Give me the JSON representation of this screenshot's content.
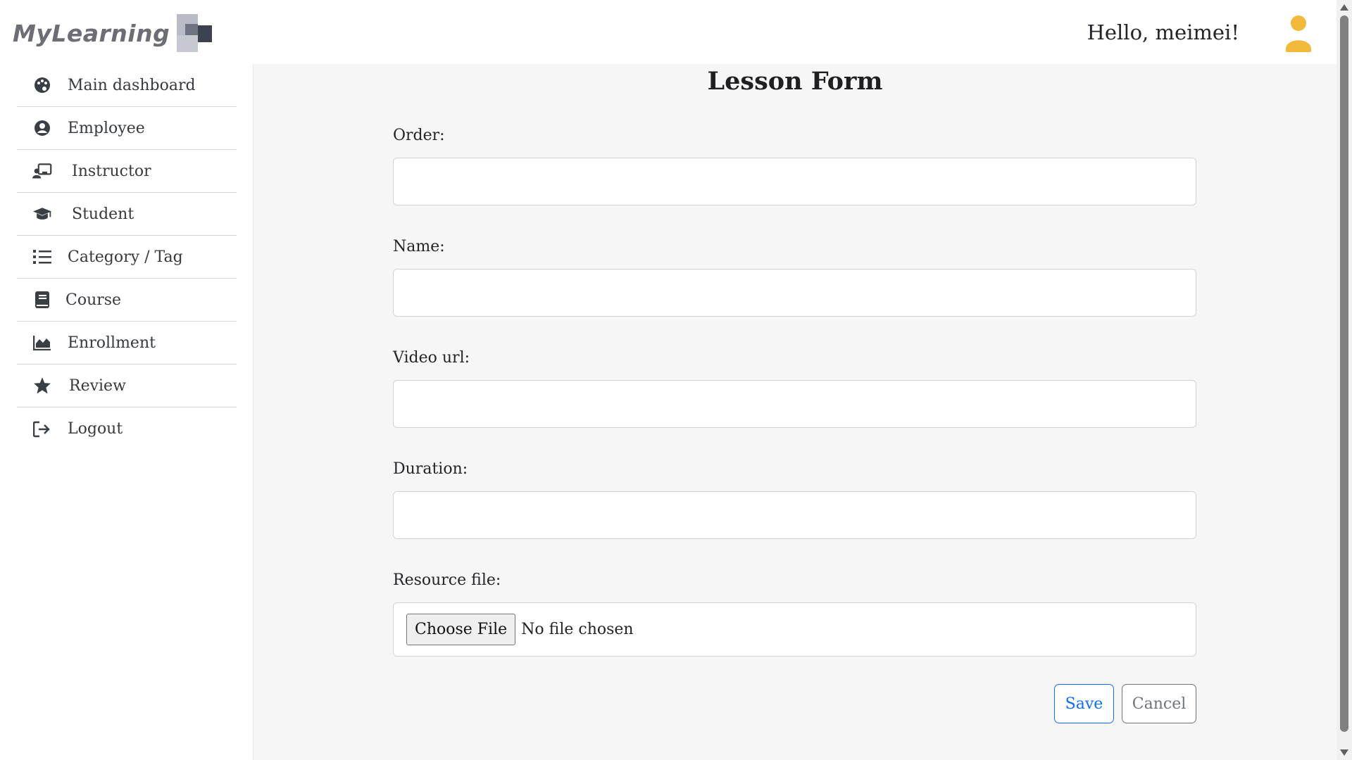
{
  "header": {
    "logo_text": "MyLearning",
    "greeting": "Hello, meimei!",
    "avatar_color": "#f2b93b"
  },
  "sidebar": {
    "items": [
      {
        "label": "Main dashboard",
        "icon": "palette-icon"
      },
      {
        "label": "Employee",
        "icon": "user-circle-icon"
      },
      {
        "label": "Instructor",
        "icon": "chalkboard-teacher-icon"
      },
      {
        "label": "Student",
        "icon": "graduation-cap-icon"
      },
      {
        "label": "Category / Tag",
        "icon": "list-icon"
      },
      {
        "label": "Course",
        "icon": "book-icon"
      },
      {
        "label": "Enrollment",
        "icon": "chart-area-icon"
      },
      {
        "label": "Review",
        "icon": "star-icon"
      },
      {
        "label": "Logout",
        "icon": "sign-out-icon"
      }
    ]
  },
  "form": {
    "title": "Lesson Form",
    "fields": {
      "order": {
        "label": "Order:",
        "value": ""
      },
      "name": {
        "label": "Name:",
        "value": ""
      },
      "video_url": {
        "label": "Video url:",
        "value": ""
      },
      "duration": {
        "label": "Duration:",
        "value": ""
      },
      "resource_file": {
        "label": "Resource file:",
        "button": "Choose File",
        "status": "No file chosen"
      }
    },
    "save_label": "Save",
    "cancel_label": "Cancel"
  },
  "colors": {
    "primary": "#0d6efd",
    "secondary": "#6c757d",
    "main_bg": "#f6f6f6"
  }
}
